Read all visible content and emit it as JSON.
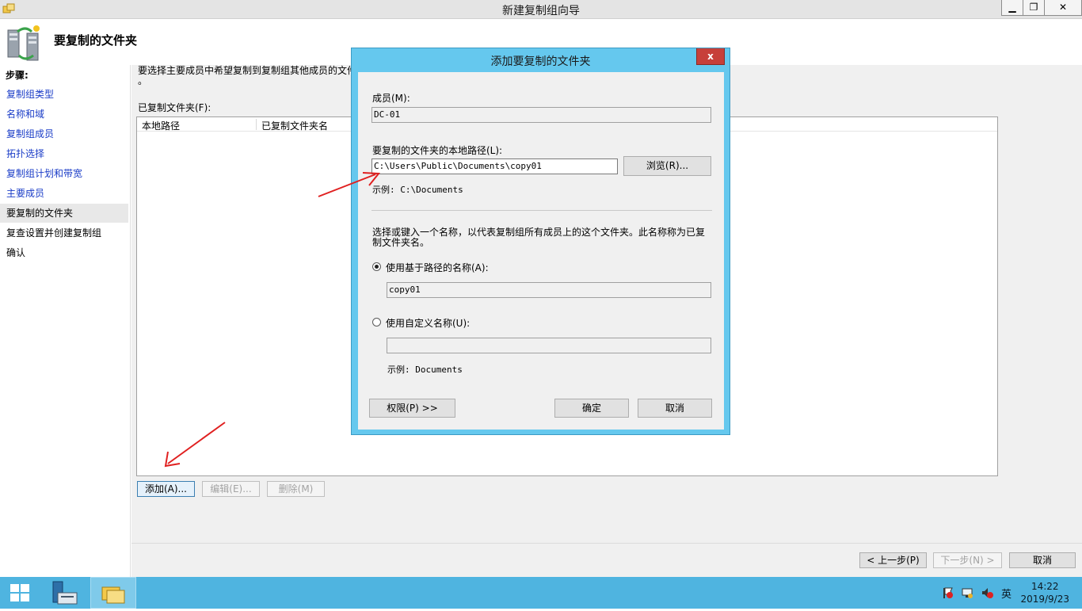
{
  "window": {
    "title": "新建复制组向导",
    "minimize_glyph": "▁",
    "restore_glyph": "❐",
    "close_glyph": "✕"
  },
  "header": {
    "title": "要复制的文件夹"
  },
  "sidebar": {
    "steps_label": "步骤:",
    "items": [
      {
        "label": "复制组类型",
        "state": "done"
      },
      {
        "label": "名称和域",
        "state": "done"
      },
      {
        "label": "复制组成员",
        "state": "done"
      },
      {
        "label": "拓扑选择",
        "state": "done"
      },
      {
        "label": "复制组计划和带宽",
        "state": "done"
      },
      {
        "label": "主要成员",
        "state": "done"
      },
      {
        "label": "要复制的文件夹",
        "state": "current"
      },
      {
        "label": "复查设置并创建复制组",
        "state": "pending"
      },
      {
        "label": "确认",
        "state": "pending"
      }
    ]
  },
  "main": {
    "description_line1": "要选择主要成员中希望复制到复制组其他成员的文件",
    "description_line2": "。",
    "folders_label": "已复制文件夹(F):",
    "columns": [
      "本地路径",
      "已复制文件夹名"
    ],
    "buttons": {
      "add": "添加(A)...",
      "edit": "编辑(E)...",
      "delete": "删除(M)"
    }
  },
  "wizard_nav": {
    "back": "< 上一步(P)",
    "next": "下一步(N) >",
    "cancel": "取消"
  },
  "dialog": {
    "title": "添加要复制的文件夹",
    "close_glyph": "x",
    "member_label": "成员(M):",
    "member_value": "DC-01",
    "path_label": "要复制的文件夹的本地路径(L):",
    "path_value": "C:\\Users\\Public\\Documents\\copy01",
    "browse": "浏览(R)...",
    "path_example": "示例: C:\\Documents",
    "name_desc_line1": "选择或键入一个名称，以代表复制组所有成员上的这个文件夹。此名称称为已复",
    "name_desc_line2": "制文件夹名。",
    "radio_path_label": "使用基于路径的名称(A):",
    "radio_path_value": "copy01",
    "radio_custom_label": "使用自定义名称(U):",
    "radio_custom_value": "",
    "name_example": "示例: Documents",
    "selected_option": "path",
    "permissions": "权限(P) >>",
    "ok": "确定",
    "cancel": "取消"
  },
  "taskbar": {
    "time": "14:22",
    "date": "2019/9/23",
    "ime": "英",
    "items": [
      "start-icon",
      "server-manager-icon",
      "file-explorer-icon"
    ],
    "tray": [
      "action-center-flag-icon",
      "network-icon",
      "volume-muted-icon"
    ]
  },
  "colors": {
    "dialog_frame": "#65c8ee",
    "taskbar": "#4fb4e0",
    "link": "#1a3cc7",
    "annotation_arrow": "#e02020"
  }
}
